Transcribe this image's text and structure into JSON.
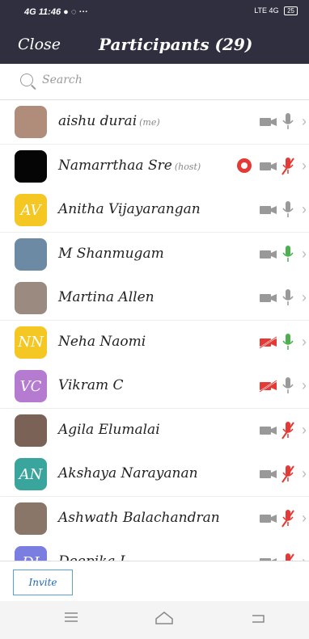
{
  "status": {
    "left": "11:46",
    "network": "4G",
    "right": "LTE 4G",
    "battery": "25"
  },
  "header": {
    "close": "Close",
    "title": "Participants (29)"
  },
  "search": {
    "placeholder": "Search"
  },
  "participants": [
    {
      "name": "aishu durai",
      "tag": "(me)",
      "avatar_text": "",
      "avatar_color": "#b08d7a",
      "cam_off": false,
      "mic": "muted-gray"
    },
    {
      "name": "Namarrthaa Sre",
      "tag": "(host)",
      "avatar_text": "",
      "avatar_color": "#050505",
      "cam_off": false,
      "mic": "muted-red",
      "recording": true
    },
    {
      "name": "Anitha Vijayarangan",
      "tag": "",
      "avatar_text": "AV",
      "avatar_color": "#f5c723",
      "cam_off": false,
      "mic": "gray"
    },
    {
      "name": "M Shanmugam",
      "tag": "",
      "avatar_text": "",
      "avatar_color": "#6d8aa5",
      "cam_off": false,
      "mic": "green"
    },
    {
      "name": "Martina Allen",
      "tag": "",
      "avatar_text": "",
      "avatar_color": "#9a8a80",
      "cam_off": false,
      "mic": "gray"
    },
    {
      "name": "Neha Naomi",
      "tag": "",
      "avatar_text": "NN",
      "avatar_color": "#f5c723",
      "cam_off": true,
      "mic": "green"
    },
    {
      "name": "Vikram C",
      "tag": "",
      "avatar_text": "VC",
      "avatar_color": "#b57bd0",
      "cam_off": true,
      "mic": "gray"
    },
    {
      "name": "Agila Elumalai",
      "tag": "",
      "avatar_text": "",
      "avatar_color": "#7b6256",
      "cam_off": false,
      "mic": "muted-red"
    },
    {
      "name": "Akshaya Narayanan",
      "tag": "",
      "avatar_text": "AN",
      "avatar_color": "#3aa59c",
      "cam_off": false,
      "mic": "muted-red"
    },
    {
      "name": "Ashwath Balachandran",
      "tag": "",
      "avatar_text": "",
      "avatar_color": "#8a7668",
      "cam_off": false,
      "mic": "muted-red"
    },
    {
      "name": "Deepika I",
      "tag": "",
      "avatar_text": "DI",
      "avatar_color": "#7a7ee0",
      "cam_off": false,
      "mic": "muted-red"
    }
  ],
  "footer": {
    "invite": "Invite"
  }
}
